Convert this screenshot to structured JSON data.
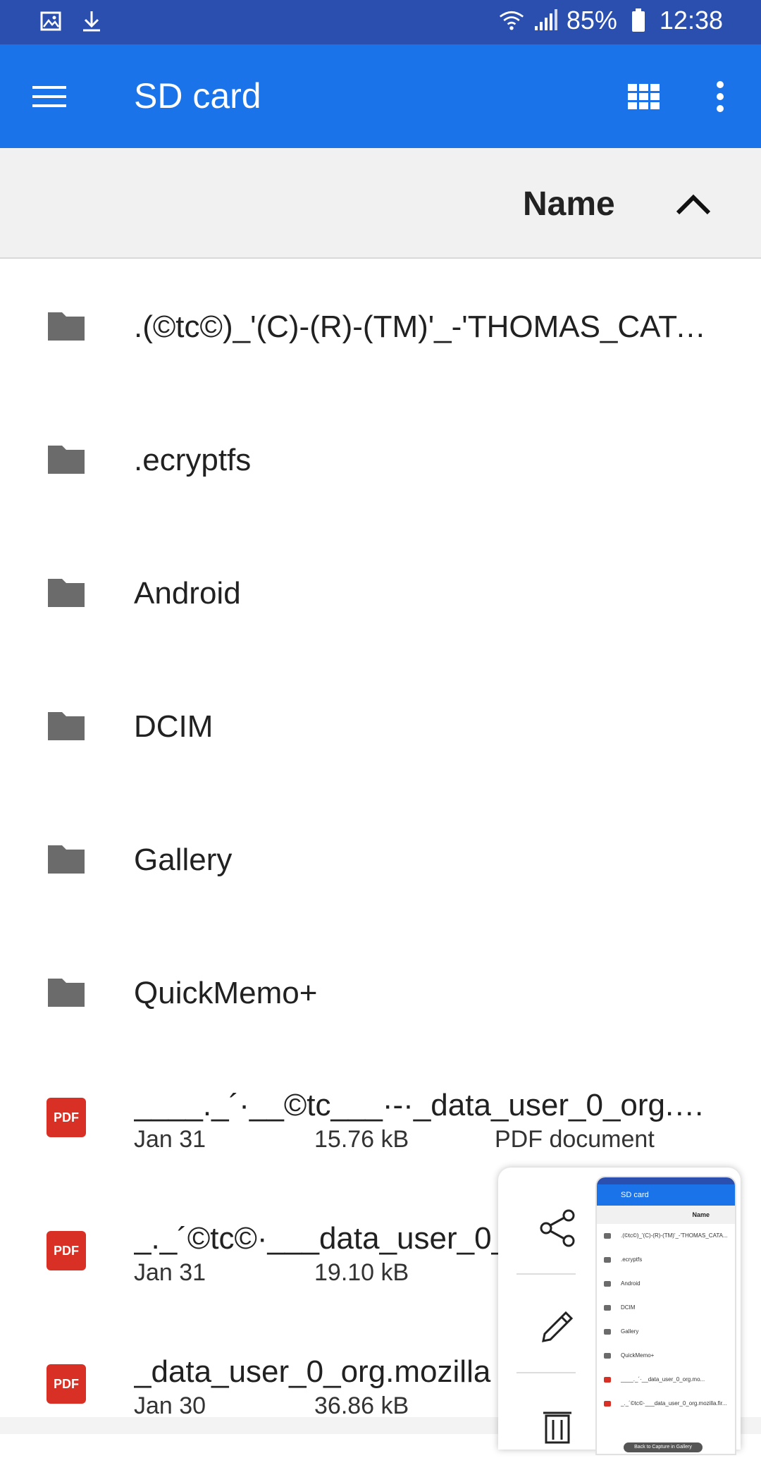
{
  "status_bar": {
    "battery": "85%",
    "time": "12:38"
  },
  "app_bar": {
    "title": "SD card"
  },
  "sort": {
    "label": "Name",
    "direction": "ascending"
  },
  "items": [
    {
      "type": "folder",
      "name": ".(©tc©)_'(C)-(R)-(TM)'_-'THOMAS_CATA…"
    },
    {
      "type": "folder",
      "name": ".ecryptfs"
    },
    {
      "type": "folder",
      "name": "Android"
    },
    {
      "type": "folder",
      "name": "DCIM"
    },
    {
      "type": "folder",
      "name": "Gallery"
    },
    {
      "type": "folder",
      "name": "QuickMemo+"
    },
    {
      "type": "pdf",
      "name": "____._´·__©tc___·-·_data_user_0_org.mo…",
      "date": "Jan 31",
      "size": "15.76 kB",
      "kind": "PDF document"
    },
    {
      "type": "pdf",
      "name": "_._´©tc©·___data_user_0_",
      "date": "Jan 31",
      "size": "19.10 kB",
      "kind": ""
    },
    {
      "type": "pdf",
      "name": "_data_user_0_org.mozilla",
      "date": "Jan 30",
      "size": "36.86 kB",
      "kind": ""
    }
  ],
  "pdf_badge_text": "PDF",
  "screenshot_panel": {
    "thumb_title": "SD card",
    "thumb_sort": "Name",
    "thumb_rows": [
      ".(©tc©)_'(C)-(R)-(TM)'_-'THOMAS_CATA...",
      ".ecryptfs",
      "Android",
      "DCIM",
      "Gallery",
      "QuickMemo+",
      "____._´·__data_user_0_org.mo...",
      "_._´©tc©·___data_user_0_org.mozilla.fir..."
    ],
    "thumb_toast": "Back to Capture in Gallery"
  },
  "colors": {
    "status_bar": "#2a4fae",
    "app_bar": "#1a73e8",
    "folder_icon": "#6b6b6b",
    "pdf_icon": "#d93025"
  }
}
